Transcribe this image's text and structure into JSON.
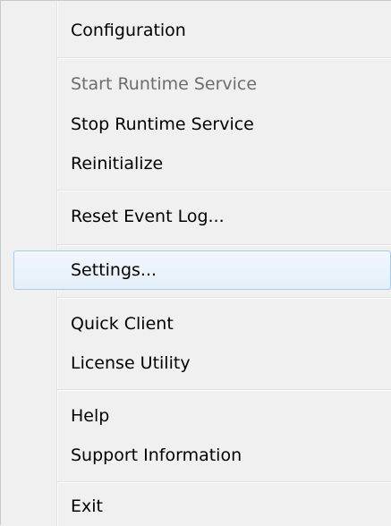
{
  "menu": {
    "items": [
      {
        "label": "Configuration"
      },
      {
        "label": "Start Runtime Service",
        "disabled": true
      },
      {
        "label": "Stop Runtime Service"
      },
      {
        "label": "Reinitialize"
      },
      {
        "label": "Reset Event Log..."
      },
      {
        "label": "Settings...",
        "highlighted": true
      },
      {
        "label": "Quick Client"
      },
      {
        "label": "License Utility"
      },
      {
        "label": "Help"
      },
      {
        "label": "Support Information"
      },
      {
        "label": "Exit"
      }
    ]
  },
  "colors": {
    "background": "#f0f0f0",
    "text": "#000000",
    "disabled_text": "#6d6d6d",
    "highlight_border": "#a8caeb",
    "highlight_fill": "#e5eff9"
  }
}
